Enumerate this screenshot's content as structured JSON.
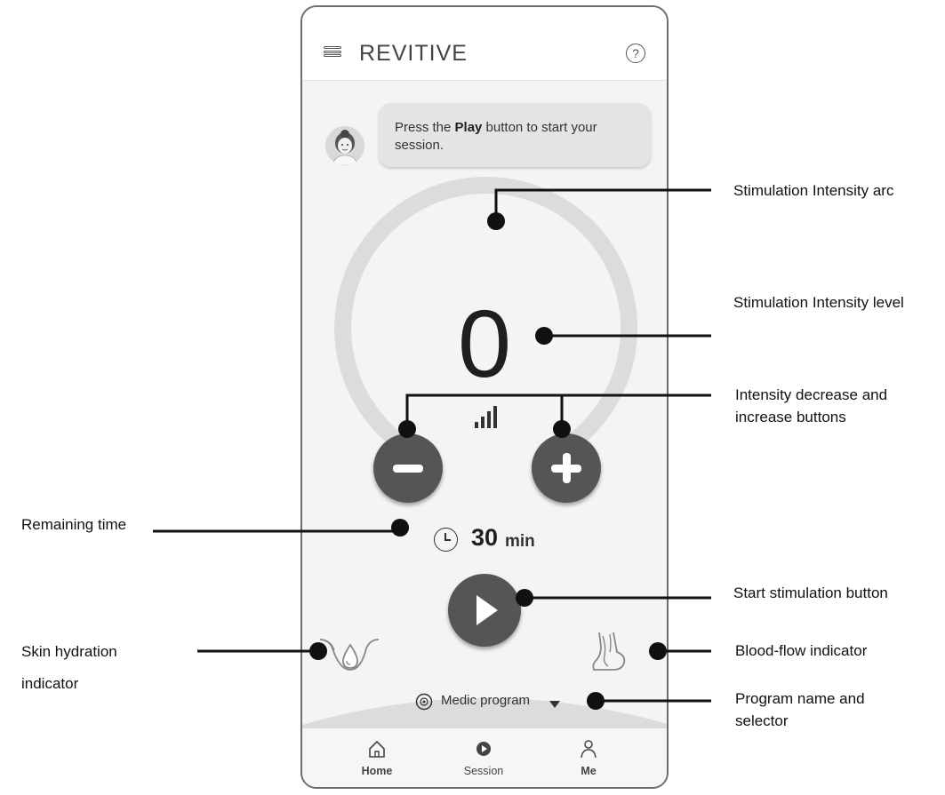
{
  "app": {
    "title": "REVITIVE",
    "menu_icon": "menu-icon",
    "help_icon": "help-icon"
  },
  "coach": {
    "message_prefix": "Press the ",
    "message_bold": "Play",
    "message_suffix": " button to start your session."
  },
  "stimulation": {
    "intensity_level": "0",
    "timer_value": "30",
    "timer_unit": "min"
  },
  "program": {
    "name": "Medic program"
  },
  "nav": {
    "items": [
      {
        "label": "Home",
        "icon": "home-icon"
      },
      {
        "label": "Session",
        "icon": "session-icon"
      },
      {
        "label": "Me",
        "icon": "person-icon"
      }
    ]
  },
  "annotations": {
    "arc": "Stimulation Intensity arc",
    "level": "Stimulation Intensity level",
    "buttons": "Intensity decrease and increase buttons",
    "remaining": "Remaining time",
    "start": "Start stimulation button",
    "hydration": "Skin hydration indicator",
    "bloodflow": "Blood-flow indicator",
    "program": "Program name and selector"
  },
  "colors": {
    "button_dark": "#555555",
    "arc_gray": "#dcdcdc",
    "bubble_gray": "#e4e4e4"
  }
}
